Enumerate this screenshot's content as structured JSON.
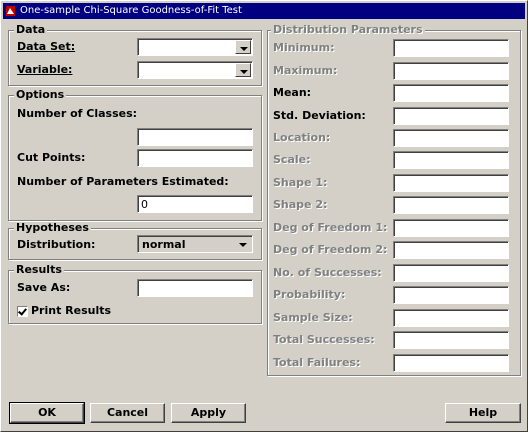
{
  "window": {
    "title": "One-sample Chi-Square Goodness-of-Fit Test",
    "icon": "app-icon"
  },
  "data_group": {
    "legend": "Data",
    "dataset_label": "Data Set:",
    "dataset_value": "",
    "variable_label": "Variable:",
    "variable_value": ""
  },
  "options_group": {
    "legend": "Options",
    "num_classes_label": "Number of Classes:",
    "num_classes_value": "",
    "cut_points_label": "Cut Points:",
    "cut_points_value": "",
    "num_params_label": "Number of Parameters Estimated:",
    "num_params_value": "0"
  },
  "hypotheses_group": {
    "legend": "Hypotheses",
    "distribution_label": "Distribution:",
    "distribution_value": "normal"
  },
  "results_group": {
    "legend": "Results",
    "save_as_label": "Save As:",
    "save_as_value": "",
    "print_results_label": "Print Results",
    "print_results_checked": true
  },
  "distribution_params": {
    "legend": "Distribution Parameters",
    "rows": [
      {
        "label": "Minimum:",
        "enabled": false,
        "value": ""
      },
      {
        "label": "Maximum:",
        "enabled": false,
        "value": ""
      },
      {
        "label": "Mean:",
        "enabled": true,
        "value": ""
      },
      {
        "label": "Std. Deviation:",
        "enabled": true,
        "value": ""
      },
      {
        "label": "Location:",
        "enabled": false,
        "value": ""
      },
      {
        "label": "Scale:",
        "enabled": false,
        "value": ""
      },
      {
        "label": "Shape 1:",
        "enabled": false,
        "value": ""
      },
      {
        "label": "Shape 2:",
        "enabled": false,
        "value": ""
      },
      {
        "label": "Deg of Freedom 1:",
        "enabled": false,
        "value": ""
      },
      {
        "label": "Deg of Freedom 2:",
        "enabled": false,
        "value": ""
      },
      {
        "label": "No. of Successes:",
        "enabled": false,
        "value": ""
      },
      {
        "label": "Probability:",
        "enabled": false,
        "value": ""
      },
      {
        "label": "Sample Size:",
        "enabled": false,
        "value": ""
      },
      {
        "label": "Total Successes:",
        "enabled": false,
        "value": ""
      },
      {
        "label": "Total Failures:",
        "enabled": false,
        "value": ""
      }
    ]
  },
  "buttons": {
    "ok": "OK",
    "cancel": "Cancel",
    "apply": "Apply",
    "help": "Help"
  }
}
